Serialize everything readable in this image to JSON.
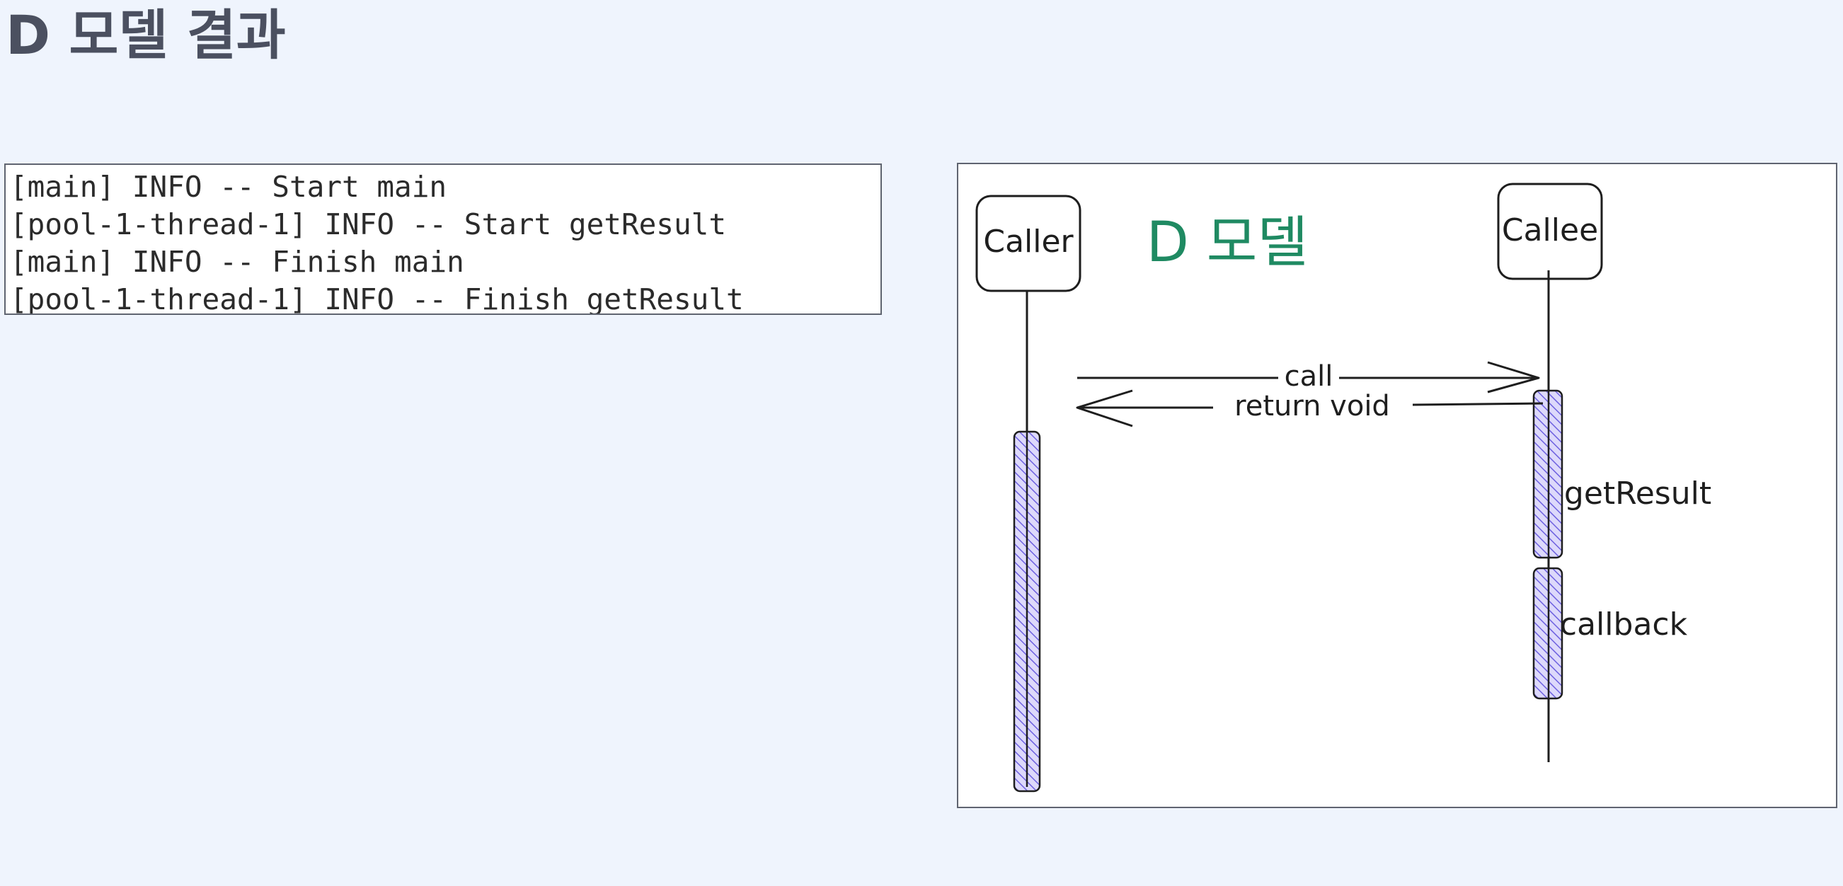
{
  "page": {
    "title": "D 모델 결과"
  },
  "log": {
    "lines": [
      "[main] INFO -- Start main",
      "[pool-1-thread-1] INFO -- Start getResult",
      "[main] INFO -- Finish main",
      "[pool-1-thread-1] INFO -- Finish getResult"
    ]
  },
  "diagram": {
    "title": "D 모델",
    "caller_label": "Caller",
    "callee_label": "Callee",
    "call_label": "call",
    "return_label": "return void",
    "activation_getresult_label": "getResult",
    "activation_callback_label": "callback",
    "colors": {
      "title_green": "#1f8a62",
      "activation_fill": "#c9c6f7",
      "activation_hatch": "#6d60e0",
      "ink": "#1e1e1e"
    }
  }
}
